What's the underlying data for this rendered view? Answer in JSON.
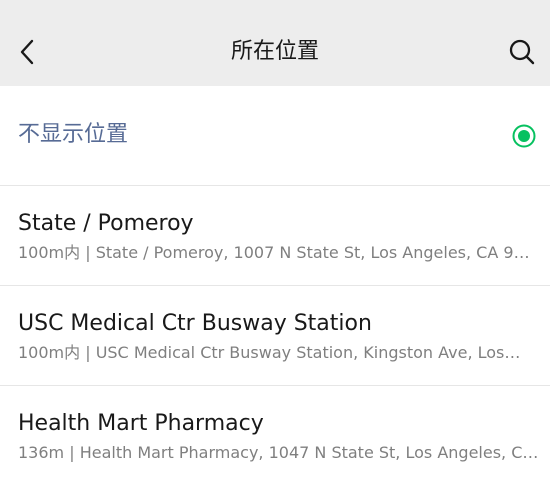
{
  "header": {
    "title": "所在位置"
  },
  "hide_location": {
    "label": "不显示位置",
    "selected": true
  },
  "places": [
    {
      "name": "State / Pomeroy",
      "detail": "100m内 | State / Pomeroy, 1007 N State St, Los Angeles, CA 9…"
    },
    {
      "name": "USC Medical Ctr Busway Station",
      "detail": "100m内 | USC Medical Ctr Busway Station, Kingston Ave, Los…"
    },
    {
      "name": "Health Mart Pharmacy",
      "detail": "136m | Health Mart Pharmacy, 1047 N State St, Los Angeles, C…"
    }
  ],
  "colors": {
    "header_bg": "#ededed",
    "link_blue": "#576b95",
    "selected_green": "#07c160"
  },
  "icons": {
    "back": "chevron-left-icon",
    "search": "search-icon",
    "selected": "radio-checked-icon"
  }
}
